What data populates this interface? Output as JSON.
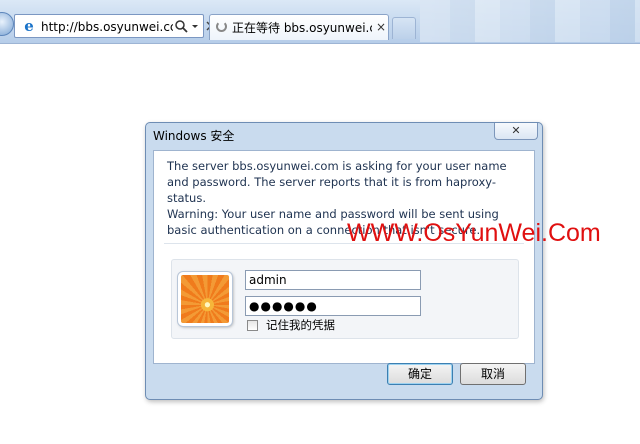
{
  "browser": {
    "address_url": "http://bbs.osyunwei.cc",
    "tab_title": "正在等待 bbs.osyunwei.c...",
    "tab_close_glyph": "×",
    "search_icon": "search-icon",
    "ie_icon": "ie-logo-icon"
  },
  "dialog": {
    "title": "Windows 安全",
    "close_glyph": "✕",
    "message": "The server bbs.osyunwei.com is asking for your user name and password. The server reports that it is from haproxy-status.",
    "warning": "Warning: Your user name and password will be sent using basic authentication on a connection that isn't secure.",
    "username": "admin",
    "password_masked": "●●●●●●",
    "remember_label": "记住我的凭据",
    "remember_checked": false,
    "ok_label": "确定",
    "cancel_label": "取消"
  },
  "watermark": {
    "text": "WWW.OsYunWei.Com",
    "color": "#e01010"
  }
}
